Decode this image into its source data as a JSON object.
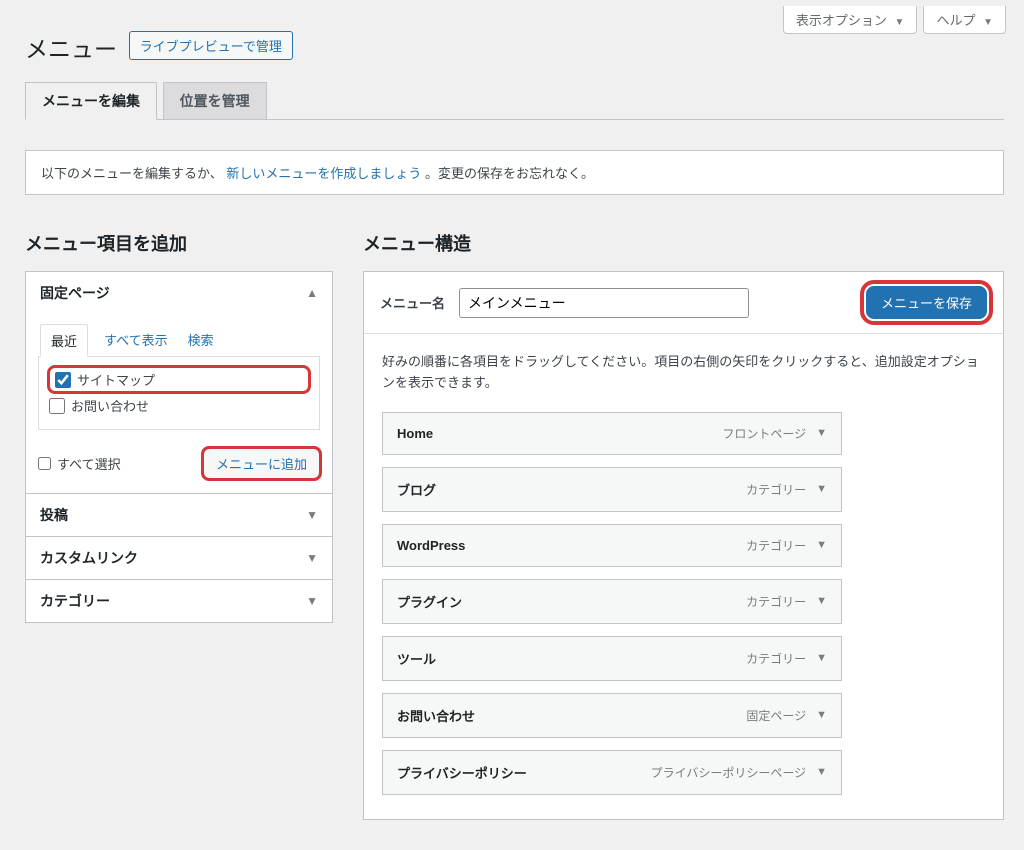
{
  "screen_meta": {
    "options_label": "表示オプション",
    "help_label": "ヘルプ"
  },
  "header": {
    "title": "メニュー",
    "live_preview": "ライブプレビューで管理"
  },
  "tabs": {
    "edit": "メニューを編集",
    "locations": "位置を管理"
  },
  "notice": {
    "prefix": "以下のメニューを編集するか、",
    "link": "新しいメニューを作成しましょう",
    "suffix": "。変更の保存をお忘れなく。"
  },
  "side": {
    "heading": "メニュー項目を追加",
    "pages_title": "固定ページ",
    "inner_tabs": {
      "recent": "最近",
      "all": "すべて表示",
      "search": "検索"
    },
    "items": [
      {
        "label": "サイトマップ",
        "checked": true
      },
      {
        "label": "お問い合わせ",
        "checked": false
      }
    ],
    "select_all": "すべて選択",
    "add_button": "メニューに追加",
    "posts_title": "投稿",
    "custom_title": "カスタムリンク",
    "category_title": "カテゴリー"
  },
  "main": {
    "heading": "メニュー構造",
    "name_label": "メニュー名",
    "name_value": "メインメニュー",
    "save_button": "メニューを保存",
    "instructions": "好みの順番に各項目をドラッグしてください。項目の右側の矢印をクリックすると、追加設定オプションを表示できます。",
    "items": [
      {
        "label": "Home",
        "type": "フロントページ"
      },
      {
        "label": "ブログ",
        "type": "カテゴリー"
      },
      {
        "label": "WordPress",
        "type": "カテゴリー"
      },
      {
        "label": "プラグイン",
        "type": "カテゴリー"
      },
      {
        "label": "ツール",
        "type": "カテゴリー"
      },
      {
        "label": "お問い合わせ",
        "type": "固定ページ"
      },
      {
        "label": "プライバシーポリシー",
        "type": "プライバシーポリシーページ"
      }
    ]
  }
}
